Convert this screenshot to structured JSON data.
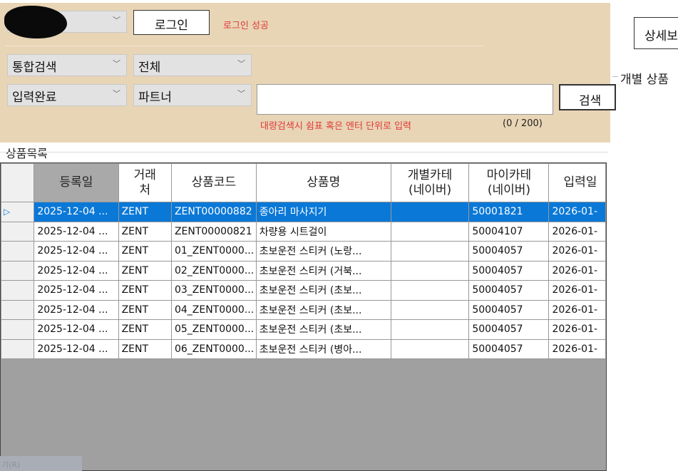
{
  "login": {
    "account_value": "",
    "login_button": "로그인",
    "status": "로그인 성공"
  },
  "filters": {
    "search_type": "통합검색",
    "scope": "전체",
    "state": "입력완료",
    "partner": "파트너",
    "query_value": "",
    "search_button": "검색",
    "hint": "대량검색시 쉼표 혹은 엔터 단위로 입력",
    "counter": "(0 / 200)"
  },
  "list": {
    "label": "상품목록",
    "columns": [
      "등록일",
      "거래\n처",
      "상품코드",
      "상품명",
      "개별카테\n(네이버)",
      "마이카테\n(네이버)",
      "입력일"
    ],
    "rows": [
      [
        "2025-12-04 ...",
        "ZENT",
        "ZENT00000882",
        "종아리 마사지기",
        "",
        "50001821",
        "2026-01-"
      ],
      [
        "2025-12-04 ...",
        "ZENT",
        "ZENT00000821",
        "차량용 시트걸이",
        "",
        "50004107",
        "2026-01-"
      ],
      [
        "2025-12-04 ...",
        "ZENT",
        "01_ZENT0000...",
        "초보운전 스티커 (노랑...",
        "",
        "50004057",
        "2026-01-"
      ],
      [
        "2025-12-04 ...",
        "ZENT",
        "02_ZENT0000...",
        "초보운전 스티커 (거북...",
        "",
        "50004057",
        "2026-01-"
      ],
      [
        "2025-12-04 ...",
        "ZENT",
        "03_ZENT0000...",
        "초보운전 스티커 (초보...",
        "",
        "50004057",
        "2026-01-"
      ],
      [
        "2025-12-04 ...",
        "ZENT",
        "04_ZENT0000...",
        "초보운전 스티커 (초보...",
        "",
        "50004057",
        "2026-01-"
      ],
      [
        "2025-12-04 ...",
        "ZENT",
        "05_ZENT0000...",
        "초보운전 스티커 (초보...",
        "",
        "50004057",
        "2026-01-"
      ],
      [
        "2025-12-04 ...",
        "ZENT",
        "06_ZENT0000...",
        "초보운전 스티커 (병아...",
        "",
        "50004057",
        "2026-01-"
      ]
    ],
    "selected_row": 0,
    "row_indicator": "▷"
  },
  "right": {
    "detail_button": "상세보",
    "group_label": "개별 상품"
  },
  "footer": {
    "faint_button": "기(R)"
  }
}
